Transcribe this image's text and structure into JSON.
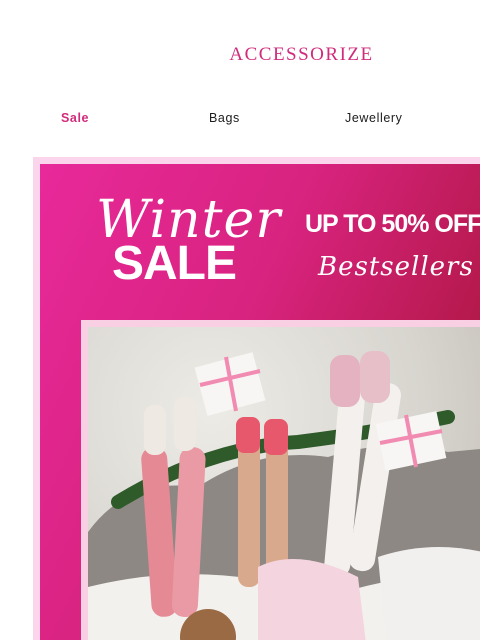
{
  "brand": {
    "logo_text": "ACCESSORIZE"
  },
  "nav": {
    "items": [
      {
        "label": "Sale"
      },
      {
        "label": "Bags"
      },
      {
        "label": "Jewellery"
      }
    ]
  },
  "banner": {
    "headline_script": "Winter",
    "headline_bold": "SALE",
    "offer_text": "UP TO 50% OFF",
    "subline_script": "Bestsellers"
  },
  "colors": {
    "brand_pink": "#d12b7c",
    "banner_gradient_start": "#e8299a",
    "banner_gradient_end": "#8f1525",
    "frame_pink": "#fbd5ec"
  }
}
